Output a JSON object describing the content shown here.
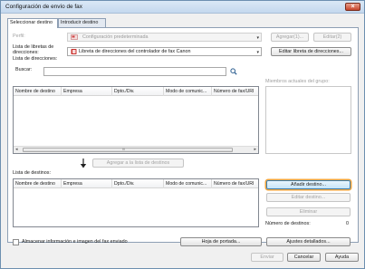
{
  "window": {
    "title": "Configuración de envío de fax"
  },
  "tabs": [
    {
      "label": "Seleccionar destino"
    },
    {
      "label": "Introducir destino"
    }
  ],
  "profile": {
    "label": "Perfil:",
    "value": "Configuración predeterminada",
    "add_label": "Agregar(1)...",
    "edit_label": "Editar(2)"
  },
  "address_book": {
    "label_line1": "Lista de libretas de",
    "label_line2": "direcciones:",
    "value": "Libreta de direcciones del controlador de fax Canon",
    "edit_button": "Editar libreta de direcciones..."
  },
  "address_list": {
    "label": "Lista de direcciones:"
  },
  "search": {
    "label": "Buscar:",
    "value": ""
  },
  "group_members": {
    "label": "Miembros actuales del grupo:"
  },
  "columns": [
    "Nombre de destino",
    "Empresa",
    "Dpto./Div.",
    "Modo de comunic...",
    "Número de fax/URI"
  ],
  "scrollbar": {
    "left": "◂",
    "right": "▸",
    "grip": "III"
  },
  "add_to_list_button": "Agregar a la lista de destinos",
  "destination_list": {
    "label": "Lista de destinos:"
  },
  "side_buttons": {
    "add": "Añadir destino...",
    "edit": "Editar destino...",
    "delete": "Eliminar"
  },
  "destination_count": {
    "label": "Número de destinos:",
    "value": "0"
  },
  "store_checkbox_label": "Almacenar información e imagen del fax enviado",
  "cover_page_button": "Hoja de portada...",
  "detail_settings_button": "Ajustes detallados...",
  "footer": {
    "send": "Enviar",
    "cancel": "Cancelar",
    "help": "Ayuda"
  },
  "colors": {
    "title_bar": "#c4d8ee",
    "close": "#c7452b",
    "focus_ring": "#f0a43c"
  }
}
